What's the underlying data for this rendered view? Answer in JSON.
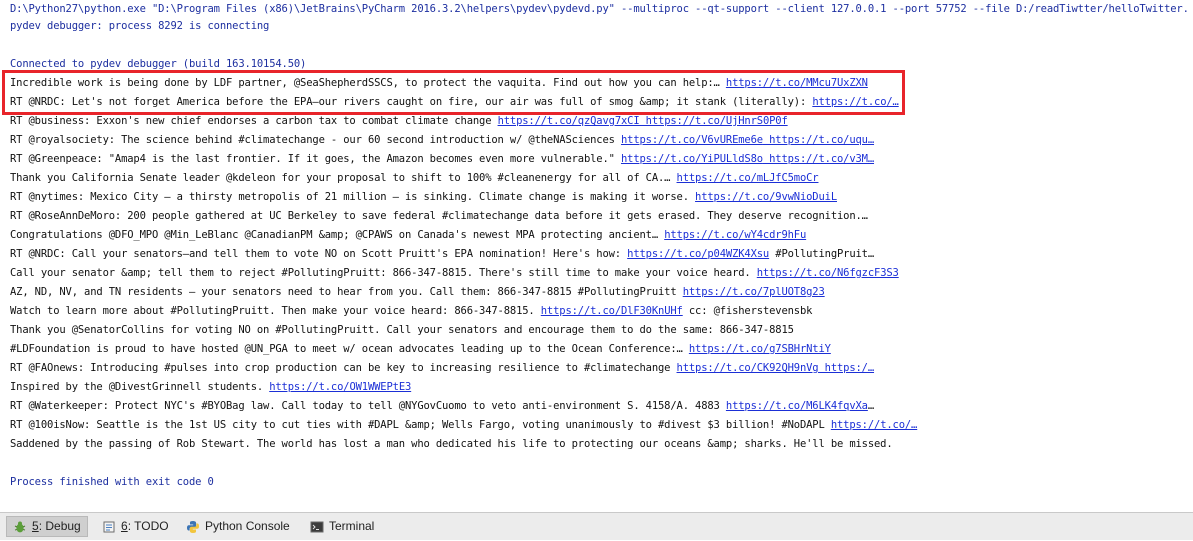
{
  "console": {
    "command": "D:\\Python27\\python.exe \"D:\\Program Files (x86)\\JetBrains\\PyCharm 2016.3.2\\helpers\\pydev\\pydevd.py\" --multiproc --qt-support --client 127.0.0.1 --port 57752 --file D:/readTiwtter/helloTwitter.py",
    "connecting": "pydev debugger: process 8292 is connecting",
    "connected": "Connected to pydev debugger (build 163.10154.50)",
    "lines": [
      {
        "text": "Incredible work is being done by LDF partner, @SeaShepherdSSCS, to protect the vaquita. Find out how you can help:… ",
        "link": "https://t.co/MMcu7UxZXN",
        "after": ""
      },
      {
        "text": "RT @NRDC: Let's not forget America before the EPA—our rivers caught on fire, our air was full of smog &amp; it stank (literally): ",
        "link": "https://t.co/…",
        "after": ""
      },
      {
        "text": "RT @business: Exxon's new chief endorses a carbon tax to combat climate change ",
        "link": "https://t.co/qzQavg7xCI",
        "after": " https://t.co/UjHnrS0P0f"
      },
      {
        "text": "RT @royalsociety: The science behind #climatechange - our 60 second introduction w/ @theNASciences ",
        "link": "https://t.co/V6vUREme6e",
        "after": " https://t.co/uqu…"
      },
      {
        "text": "RT @Greenpeace: \"Amap4 is the last frontier. If it goes, the Amazon becomes even more vulnerable.\" ",
        "link": "https://t.co/YiPULldS8o",
        "after": " https://t.co/v3M…"
      },
      {
        "text": "Thank you California Senate leader @kdeleon for your proposal to shift to 100% #cleanenergy for all of CA.… ",
        "link": "https://t.co/mLJfC5moCr",
        "after": ""
      },
      {
        "text": "RT @nytimes: Mexico City — a thirsty metropolis of 21 million — is sinking. Climate change is making it worse. ",
        "link": "https://t.co/9vwNioDuiL",
        "after": ""
      },
      {
        "text": "RT @RoseAnnDeMoro: 200 people gathered at UC Berkeley to save federal #climatechange data before it gets erased. They deserve recognition.…",
        "link": "",
        "after": ""
      },
      {
        "text": "Congratulations @DFO_MPO @Min_LeBlanc @CanadianPM &amp; @CPAWS on Canada's newest MPA protecting ancient… ",
        "link": "https://t.co/wY4cdr9hFu",
        "after": ""
      },
      {
        "text": "RT @NRDC: Call your senators—and tell them to vote NO on Scott Pruitt's EPA nomination! Here's how: ",
        "link": "https://t.co/p04WZK4Xsu",
        "after": " #PollutingPruit…"
      },
      {
        "text": "Call your senator &amp; tell them to reject #PollutingPruitt: 866-347-8815. There's still time to make your voice heard. ",
        "link": "https://t.co/N6fgzcF3S3",
        "after": ""
      },
      {
        "text": "AZ, ND, NV, and TN residents — your senators need to hear from you. Call them: 866-347-8815 #PollutingPruitt ",
        "link": "https://t.co/7plUOT8g23",
        "after": ""
      },
      {
        "text": "Watch to learn more about #PollutingPruitt. Then make your voice heard: 866-347-8815. ",
        "link": "https://t.co/DlF30KnUHf",
        "after": " cc: @fisherstevensbk"
      },
      {
        "text": "Thank you @SenatorCollins for voting NO on #PollutingPruitt. Call your senators and encourage them to do the same: 866-347-8815",
        "link": "",
        "after": ""
      },
      {
        "text": "#LDFoundation is proud to have hosted @UN_PGA to meet w/ ocean advocates leading up to the Ocean Conference:… ",
        "link": "https://t.co/g7SBHrNtiY",
        "after": ""
      },
      {
        "text": "RT @FAOnews: Introducing #pulses into crop production can be key to increasing resilience to #climatechange ",
        "link": "https://t.co/CK92QH9nVg",
        "after": " https:/…"
      },
      {
        "text": "Inspired by the @DivestGrinnell students. ",
        "link": "https://t.co/OW1WWEPtE3",
        "after": ""
      },
      {
        "text": "RT @Waterkeeper: Protect NYC's #BYOBag law. Call today to tell @NYGovCuomo to veto anti-environment S. 4158/A. 4883 ",
        "link": "https://t.co/M6LK4fqvXa",
        "after": "…"
      },
      {
        "text": "RT @100isNow: Seattle is the 1st US city to cut ties with #DAPL &amp; Wells Fargo, voting unanimously to #divest $3 billion! #NoDAPL ",
        "link": "https://t.co/…",
        "after": ""
      },
      {
        "text": "Saddened by the passing of Rob Stewart. The world has lost a man who dedicated his life to protecting our oceans &amp; sharks. He'll be missed.",
        "link": "",
        "after": ""
      }
    ],
    "exit": "Process finished with exit code 0"
  },
  "bottom_bar": {
    "tabs": [
      {
        "key": "5",
        "label": ": Debug",
        "icon": "bug-icon"
      },
      {
        "key": "6",
        "label": ": TODO",
        "icon": "todo-icon"
      },
      {
        "key": "",
        "label": "Python Console",
        "icon": "python-icon"
      },
      {
        "key": "",
        "label": "Terminal",
        "icon": "terminal-icon"
      }
    ]
  },
  "colors": {
    "highlight": "#e8242a",
    "link": "#1b2fd6",
    "info": "#1d2fa0"
  }
}
